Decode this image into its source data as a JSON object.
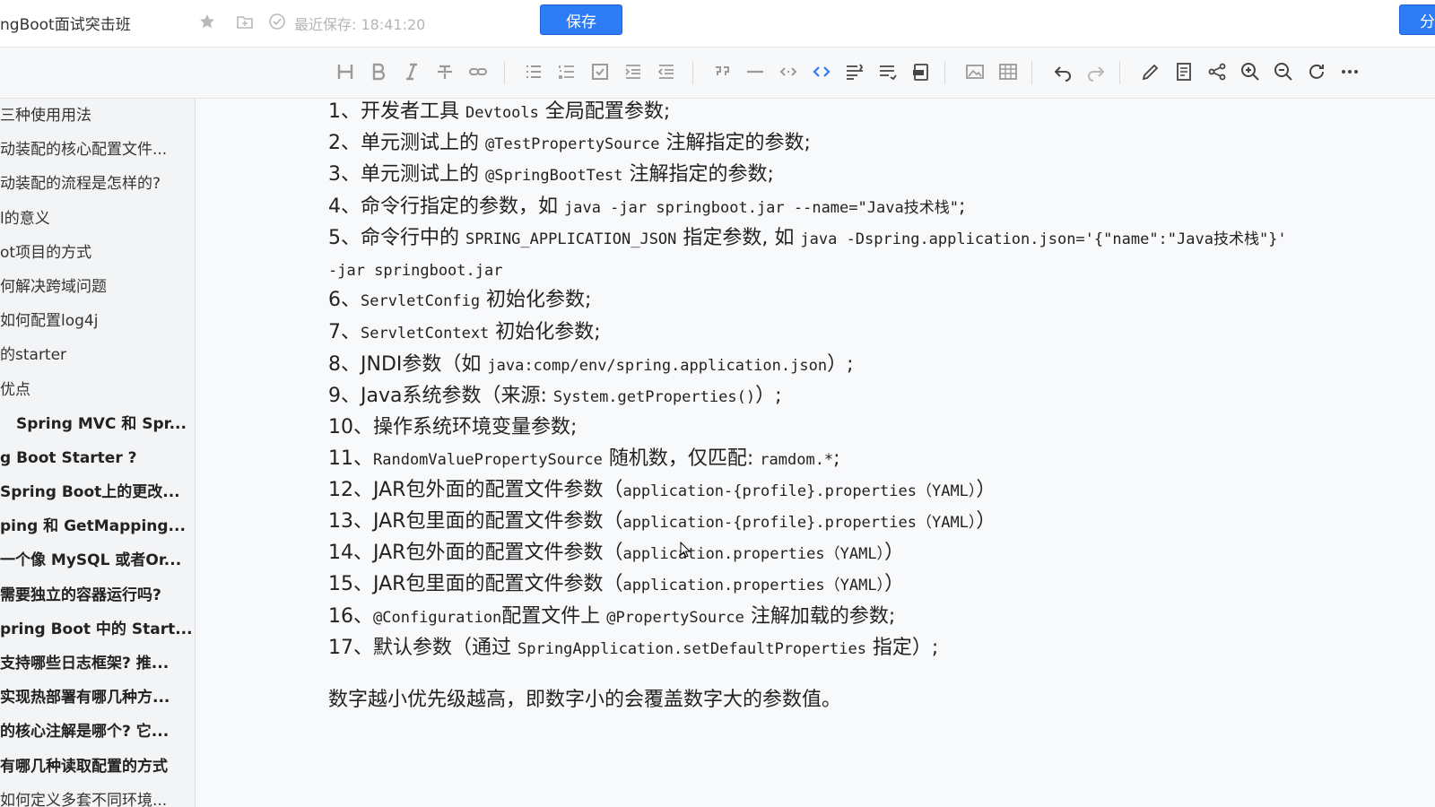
{
  "header": {
    "doc_title": "ngBoot面试突击班",
    "save_status": "最近保存: 18:41:20",
    "save_label": "保存",
    "share_label": "分"
  },
  "toolbar": {
    "icons": [
      "heading-icon",
      "bold-icon",
      "italic-icon",
      "strikethrough-icon",
      "link-icon",
      "unordered-list-icon",
      "ordered-list-icon",
      "checklist-icon",
      "indent-icon",
      "outdent-icon",
      "quote-icon",
      "horizontal-rule-icon",
      "inline-code-icon",
      "code-block-icon",
      "align-icon",
      "wrap-icon",
      "export-icon",
      "image-icon",
      "table-icon",
      "undo-icon",
      "redo-icon",
      "edit-icon",
      "note-icon",
      "share-icon",
      "zoom-in-icon",
      "zoom-out-icon",
      "refresh-icon",
      "more-icon"
    ]
  },
  "sidebar": {
    "items": [
      {
        "label": "三种使用用法",
        "bold": false
      },
      {
        "label": "动装配的核心配置文件...",
        "bold": false
      },
      {
        "label": "动装配的流程是怎样的?",
        "bold": false
      },
      {
        "label": "l的意义",
        "bold": false
      },
      {
        "label": "ot项目的方式",
        "bold": false
      },
      {
        "label": "何解决跨域问题",
        "bold": false
      },
      {
        "label": "如何配置log4j",
        "bold": false
      },
      {
        "label": "的starter",
        "bold": false
      },
      {
        "label": "优点",
        "bold": false
      },
      {
        "label": "Spring MVC 和 Spr...",
        "bold": true,
        "indent": true
      },
      {
        "label": "g Boot Starter ?",
        "bold": true
      },
      {
        "label": "Spring Boot上的更改...",
        "bold": true
      },
      {
        "label": "ping 和 GetMapping...",
        "bold": true
      },
      {
        "label": "一个像 MySQL 或者Or...",
        "bold": true
      },
      {
        "label": "需要独立的容器运行吗?",
        "bold": true
      },
      {
        "label": "pring Boot 中的 Start...",
        "bold": true
      },
      {
        "label": "支持哪些日志框架? 推...",
        "bold": true
      },
      {
        "label": "实现热部署有哪几种方...",
        "bold": true
      },
      {
        "label": "的核心注解是哪个? 它...",
        "bold": true
      },
      {
        "label": "有哪几种读取配置的方式",
        "bold": true
      },
      {
        "label": "如何定义多套不同环境...",
        "bold": false
      }
    ]
  },
  "content": {
    "lines": [
      {
        "num": "1、",
        "parts": [
          {
            "t": "开发者工具 "
          },
          {
            "c": "Devtools"
          },
          {
            "t": " 全局配置参数;"
          }
        ]
      },
      {
        "num": "2、",
        "parts": [
          {
            "t": "单元测试上的 "
          },
          {
            "c": "@TestPropertySource"
          },
          {
            "t": " 注解指定的参数;"
          }
        ]
      },
      {
        "num": "3、",
        "parts": [
          {
            "t": "单元测试上的 "
          },
          {
            "c": "@SpringBootTest"
          },
          {
            "t": " 注解指定的参数;"
          }
        ]
      },
      {
        "num": "4、",
        "parts": [
          {
            "t": "命令行指定的参数，如 "
          },
          {
            "c": "java -jar springboot.jar --name=\"Java技术栈\""
          },
          {
            "t": ";"
          }
        ]
      },
      {
        "num": "5、",
        "parts": [
          {
            "t": "命令行中的 "
          },
          {
            "c": "SPRING_APPLICATION_JSON"
          },
          {
            "t": " 指定参数, 如 "
          },
          {
            "c": "java -Dspring.application.json='{\"name\":\"Java技术栈\"}'"
          }
        ]
      },
      {
        "num": "",
        "parts": [
          {
            "c": "-jar springboot.jar"
          }
        ]
      },
      {
        "num": "6、",
        "parts": [
          {
            "c": "ServletConfig"
          },
          {
            "t": " 初始化参数;"
          }
        ]
      },
      {
        "num": "7、",
        "parts": [
          {
            "c": "ServletContext"
          },
          {
            "t": " 初始化参数;"
          }
        ]
      },
      {
        "num": "8、",
        "parts": [
          {
            "t": "JNDI参数（如 "
          },
          {
            "c": "java:comp/env/spring.application.json"
          },
          {
            "t": "）;"
          }
        ]
      },
      {
        "num": "9、",
        "parts": [
          {
            "t": "Java系统参数（来源: "
          },
          {
            "c": "System.getProperties()"
          },
          {
            "t": "）;"
          }
        ]
      },
      {
        "num": "10、",
        "parts": [
          {
            "t": "操作系统环境变量参数;"
          }
        ]
      },
      {
        "num": "11、",
        "parts": [
          {
            "c": "RandomValuePropertySource"
          },
          {
            "t": " 随机数，仅匹配: "
          },
          {
            "c": "ramdom.*"
          },
          {
            "t": ";"
          }
        ]
      },
      {
        "num": "12、",
        "parts": [
          {
            "t": "JAR包外面的配置文件参数（"
          },
          {
            "c": "application-{profile}.properties（YAML）"
          },
          {
            "t": "）"
          }
        ]
      },
      {
        "num": "13、",
        "parts": [
          {
            "t": "JAR包里面的配置文件参数（"
          },
          {
            "c": "application-{profile}.properties（YAML）"
          },
          {
            "t": "）"
          }
        ]
      },
      {
        "num": "14、",
        "parts": [
          {
            "t": "JAR包外面的配置文件参数（"
          },
          {
            "c": "application.properties（YAML）"
          },
          {
            "t": "）"
          }
        ]
      },
      {
        "num": "15、",
        "parts": [
          {
            "t": "JAR包里面的配置文件参数（"
          },
          {
            "c": "application.properties（YAML）"
          },
          {
            "t": "）"
          }
        ]
      },
      {
        "num": "16、",
        "parts": [
          {
            "c": "@Configuration"
          },
          {
            "t": "配置文件上 "
          },
          {
            "c": "@PropertySource"
          },
          {
            "t": " 注解加载的参数;"
          }
        ]
      },
      {
        "num": "17、",
        "parts": [
          {
            "t": "默认参数（通过 "
          },
          {
            "c": "SpringApplication.setDefaultProperties"
          },
          {
            "t": " 指定）;"
          }
        ]
      }
    ],
    "summary": "数字越小优先级越高，即数字小的会覆盖数字大的参数值。"
  }
}
